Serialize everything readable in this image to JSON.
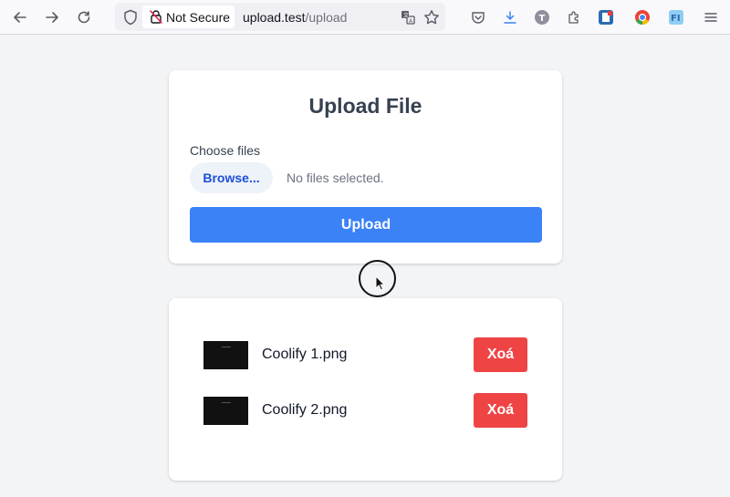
{
  "browser": {
    "security_label": "Not Secure",
    "url_host": "upload.test",
    "url_path": "/upload"
  },
  "upload_card": {
    "title": "Upload File",
    "choose_label": "Choose files",
    "browse_label": "Browse...",
    "no_files_text": "No files selected.",
    "upload_label": "Upload"
  },
  "files": [
    {
      "name": "Coolify 1.png",
      "delete_label": "Xoá"
    },
    {
      "name": "Coolify 2.png",
      "delete_label": "Xoá"
    }
  ],
  "colors": {
    "primary": "#3b82f6",
    "danger": "#ef4444",
    "page_bg": "#f3f4f6"
  }
}
